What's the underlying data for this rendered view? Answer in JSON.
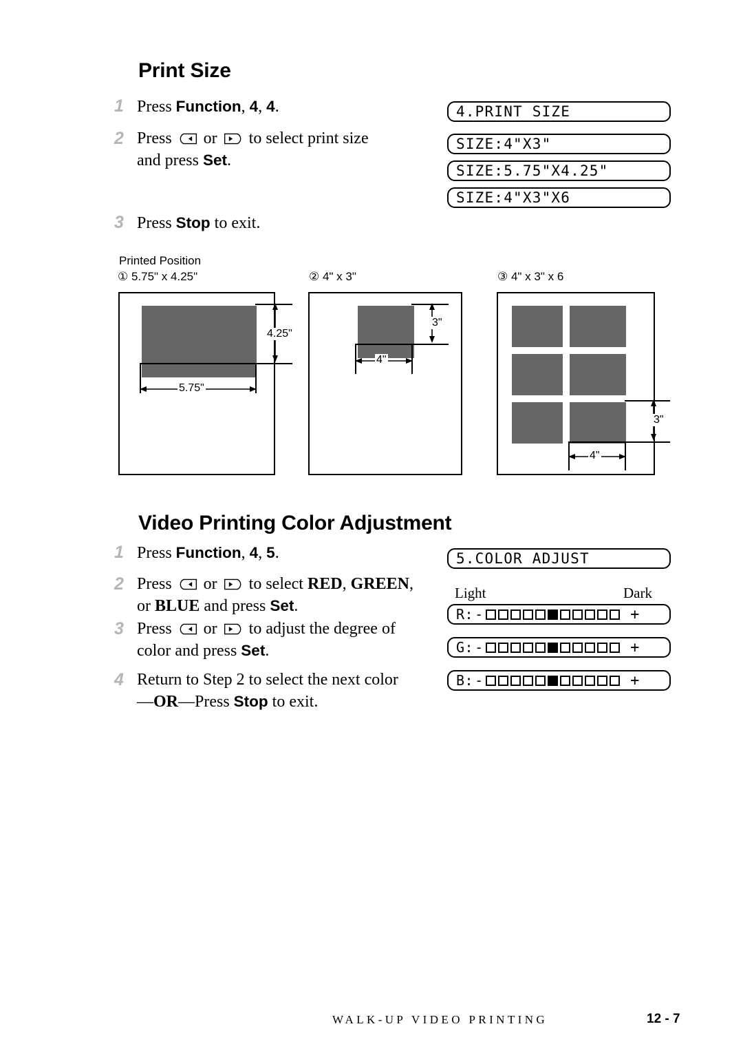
{
  "sections": [
    {
      "heading": "Print Size",
      "steps": [
        {
          "num": "1",
          "html": "Press <b>Function</b>, <b>4</b>, <b>4</b>."
        },
        {
          "num": "2",
          "html": "Press [LEFT] or [RIGHT] to select print size<br>and press <b>Set</b>."
        },
        {
          "num": "3",
          "html": "Press <b>Stop</b> to exit."
        }
      ],
      "lcd": [
        "4.PRINT SIZE",
        "SIZE:4\"X3\"",
        "SIZE:5.75\"X4.25\"",
        "SIZE:4\"X3\"X6"
      ]
    },
    {
      "heading": "Video Printing Color Adjustment",
      "steps": [
        {
          "num": "1",
          "html": "Press <b>Function</b>, <b>4</b>, <b>5</b>."
        },
        {
          "num": "2",
          "html": "Press [LEFT] or [RIGHT] to select <span class=\"sb\">RED</span>, <span class=\"sb\">GREEN</span>,<br>or <span class=\"sb\">BLUE</span> and press <b>Set</b>."
        },
        {
          "num": "3",
          "html": "Press [LEFT] or [RIGHT] to adjust the degree of<br>color and press <b>Set</b>."
        },
        {
          "num": "4",
          "html": "Return to Step 2 to select the next color<br>&mdash;<span class=\"sb\">OR</span>&mdash;Press <b>Stop</b> to exit."
        }
      ],
      "lcd_title": "5.COLOR ADJUST",
      "scale_light": "Light",
      "scale_dark": "Dark",
      "color_bars": [
        {
          "label": "R:",
          "minus": "-",
          "plus": "+",
          "cells": 11,
          "filled_index": 5
        },
        {
          "label": "G:",
          "minus": "-",
          "plus": "+",
          "cells": 11,
          "filled_index": 5
        },
        {
          "label": "B:",
          "minus": "-",
          "plus": "+",
          "cells": 11,
          "filled_index": 5
        }
      ]
    }
  ],
  "figure": {
    "title": "Printed Position",
    "panels": [
      {
        "caption": "① 5.75\" x 4.25\"",
        "width_label": "5.75\"",
        "height_label": "4.25\""
      },
      {
        "caption": "② 4\" x 3\"",
        "width_label": "4\"",
        "height_label": "3\""
      },
      {
        "caption": "③ 4\" x 3\" x 6",
        "width_label": "4\"",
        "height_label": "3\""
      }
    ]
  },
  "footer": {
    "title": "WALK-UP VIDEO PRINTING",
    "page": "12 - 7"
  },
  "colors": {
    "swatch_gray": "#666666",
    "step_number_gray": "#b5b5b5",
    "ink": "#000000"
  }
}
